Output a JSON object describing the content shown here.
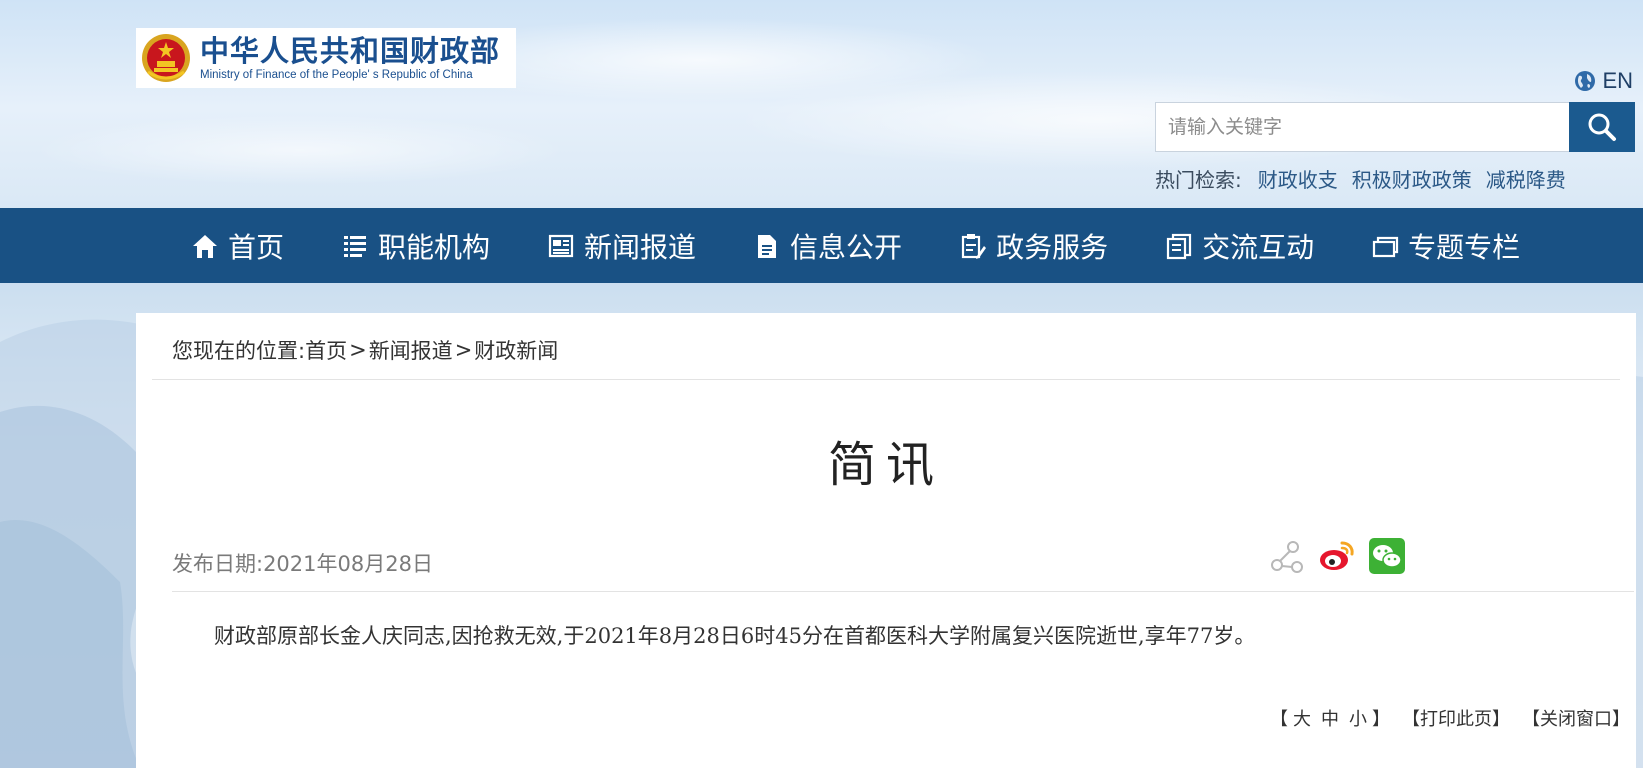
{
  "logo": {
    "cn": "中华人民共和国财政部",
    "en": "Ministry of Finance of the People' s Republic of China"
  },
  "lang": {
    "label": "EN",
    "icon": "globe-icon"
  },
  "search": {
    "placeholder": "请输入关键字",
    "value": "",
    "icon": "search-icon"
  },
  "hot": {
    "label": "热门检索:",
    "items": [
      "财政收支",
      "积极财政政策",
      "减税降费"
    ]
  },
  "nav": {
    "items": [
      {
        "label": "首页",
        "icon": "home-icon"
      },
      {
        "label": "职能机构",
        "icon": "list-icon"
      },
      {
        "label": "新闻报道",
        "icon": "newspaper-icon"
      },
      {
        "label": "信息公开",
        "icon": "document-icon"
      },
      {
        "label": "政务服务",
        "icon": "clipboard-edit-icon"
      },
      {
        "label": "交流互动",
        "icon": "chat-doc-icon"
      },
      {
        "label": "专题专栏",
        "icon": "folder-icon"
      }
    ]
  },
  "breadcrumb": {
    "prefix": "您现在的位置:",
    "items": [
      "首页",
      "新闻报道",
      "财政新闻"
    ],
    "separator": ">"
  },
  "article": {
    "title": "简讯",
    "date": "发布日期:2021年08月28日",
    "body": "财政部原部长金人庆同志,因抢救无效,于2021年8月28日6时45分在首都医科大学附属复兴医院逝世,享年77岁。"
  },
  "share": {
    "items": [
      "share-icon",
      "weibo-icon",
      "wechat-icon"
    ]
  },
  "tools": {
    "open": "【",
    "close": "】",
    "sizes": [
      "大",
      "中",
      "小"
    ],
    "print": "【打印此页】",
    "close_window": "【关闭窗口】"
  },
  "colors": {
    "nav_bg": "#195184",
    "brand_blue": "#1a4f8f",
    "search_btn": "#1b5a8f"
  }
}
